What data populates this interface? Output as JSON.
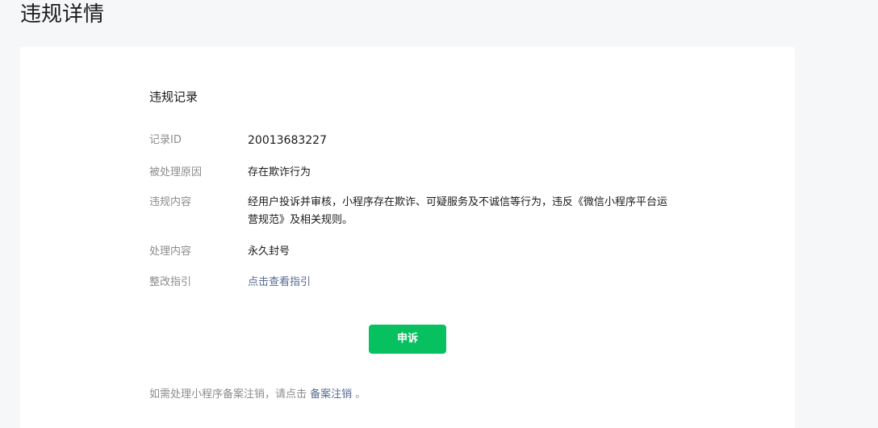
{
  "page": {
    "title": "违规详情"
  },
  "record": {
    "section_title": "违规记录",
    "rows": [
      {
        "label": "记录ID",
        "value": "20013683227"
      },
      {
        "label": "被处理原因",
        "value": "存在欺诈行为"
      },
      {
        "label": "违规内容",
        "value": "经用户投诉并审核，小程序存在欺诈、可疑服务及不诚信等行为，违反《微信小程序平台运营规范》及相关规则。"
      },
      {
        "label": "处理内容",
        "value": "永久封号"
      },
      {
        "label": "整改指引",
        "value": "点击查看指引"
      }
    ]
  },
  "actions": {
    "appeal_label": "申诉"
  },
  "footer": {
    "note_prefix": "如需处理小程序备案注销，请点击 ",
    "link_label": "备案注销",
    "note_suffix": " 。"
  },
  "colors": {
    "background": "#f6f7f9",
    "card": "#ffffff",
    "primary_green": "#07c160",
    "link": "#576b95",
    "label_gray": "#8c8c8c",
    "text": "#1a1a1a"
  }
}
